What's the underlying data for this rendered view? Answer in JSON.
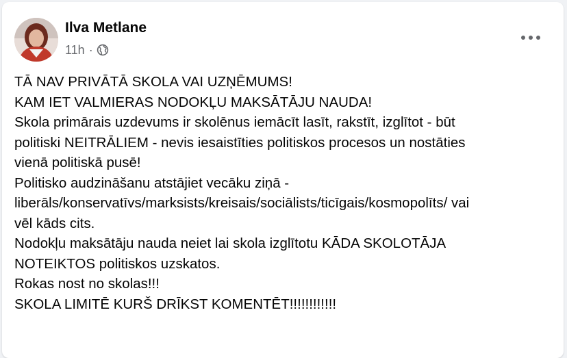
{
  "post": {
    "author": "Ilva Metlane",
    "time": "11h",
    "separator": "·",
    "visibility_icon": "globe-icon",
    "more_icon": "more-options-icon",
    "lines": [
      "TĀ NAV PRIVĀTĀ SKOLA VAI UZŅĒMUMS!",
      "KAM IET VALMIERAS NODOKĻU MAKSĀTĀJU NAUDA!",
      "Skola primārais uzdevums ir skolēnus iemācīt lasīt, rakstīt, izglītot - būt",
      "politiski NEITRĀLIEM -  nevis iesaistīties politiskos procesos un nostāties",
      "vienā politiskā pusē!",
      "Politisko audzināšanu atstājiet vecāku ziņā -",
      "liberāls/konservatīvs/marksists/kreisais/sociālists/ticīgais/kosmopolīts/ vai",
      "vēl kāds cits.",
      "Nodokļu maksātāju nauda neiet lai skola izglītotu KĀDA SKOLOTĀJA",
      "NOTEIKTOS  politiskos uzskatos.",
      "Rokas nost no skolas!!!",
      "SKOLA LIMITĒ KURŠ DRĪKST KOMENTĒT!!!!!!!!!!!!"
    ]
  },
  "colors": {
    "background": "#f0f2f5",
    "card": "#ffffff",
    "text": "#050505",
    "secondary_text": "#65676b"
  }
}
